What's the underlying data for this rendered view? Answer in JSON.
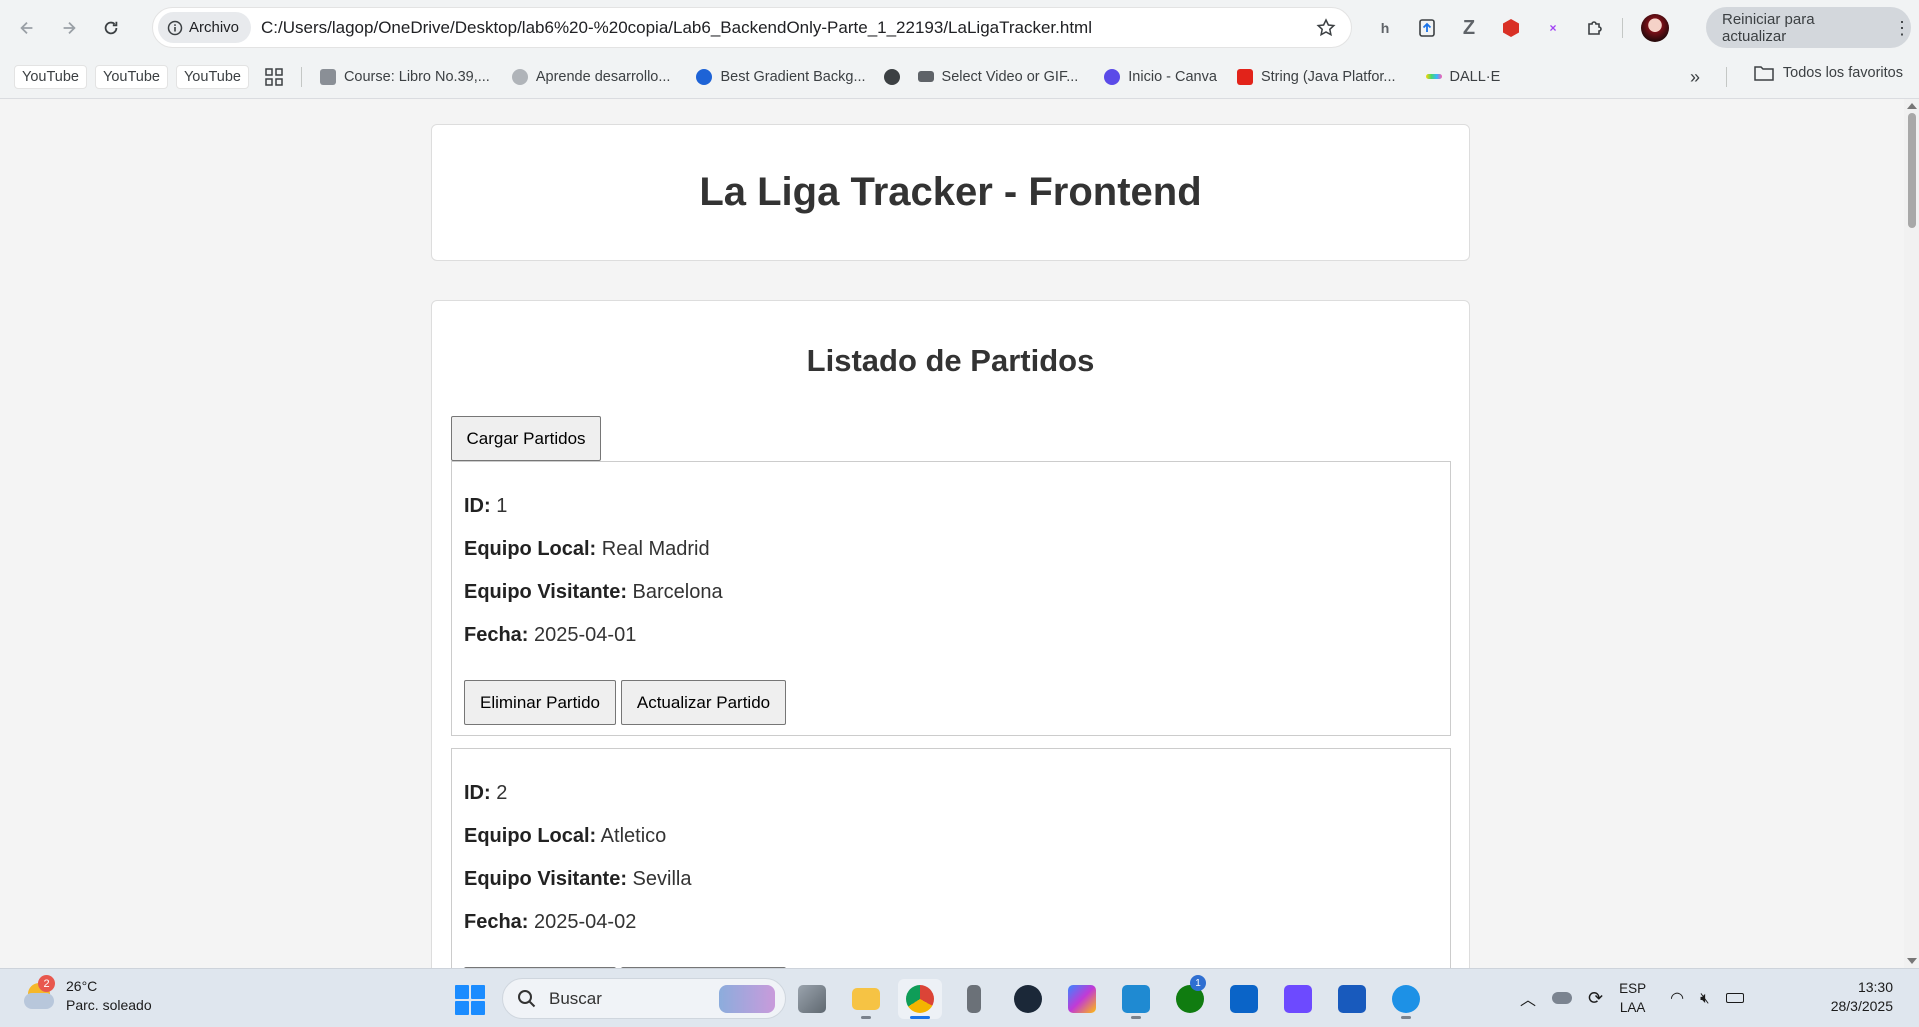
{
  "browser": {
    "chip_label": "Archivo",
    "url": "C:/Users/lagop/OneDrive/Desktop/lab6%20-%20copia/Lab6_BackendOnly-Parte_1_22193/LaLigaTracker.html",
    "restart_label": "Reiniciar para actualizar",
    "bookmarks": [
      {
        "label": "YouTube",
        "icon": "youtube-chip"
      },
      {
        "label": "YouTube",
        "icon": "youtube-chip"
      },
      {
        "label": "YouTube",
        "icon": "youtube-chip"
      },
      {
        "label": "Course: Libro No.39,...",
        "icon": "course-icon"
      },
      {
        "label": "Aprende desarrollo...",
        "icon": "unity-icon"
      },
      {
        "label": "Best Gradient Backg...",
        "icon": "shield-blue-icon"
      },
      {
        "label": "",
        "icon": "globe-icon"
      },
      {
        "label": "Select Video or GIF...",
        "icon": "video-icon"
      },
      {
        "label": "Inicio - Canva",
        "icon": "canva-icon"
      },
      {
        "label": "String (Java Platfor...",
        "icon": "oracle-icon"
      },
      {
        "label": "DALL·E",
        "icon": "dalle-icon"
      }
    ],
    "all_bookmarks_label": "Todos los favoritos"
  },
  "page": {
    "title": "La Liga Tracker - Frontend",
    "list_heading": "Listado de Partidos",
    "load_button": "Cargar Partidos",
    "labels": {
      "id": "ID:",
      "home": "Equipo Local:",
      "away": "Equipo Visitante:",
      "date": "Fecha:"
    },
    "delete_button": "Eliminar Partido",
    "update_button": "Actualizar Partido",
    "matches": [
      {
        "id": "1",
        "home": "Real Madrid",
        "away": "Barcelona",
        "date": "2025-04-01"
      },
      {
        "id": "2",
        "home": "Atletico",
        "away": "Sevilla",
        "date": "2025-04-02"
      }
    ]
  },
  "taskbar": {
    "weather_badge": "2",
    "temperature": "26°C",
    "condition": "Parc. soleado",
    "search_placeholder": "Buscar",
    "xbox_badge": "1",
    "language_top": "ESP",
    "language_bottom": "LAA",
    "time": "13:30",
    "date": "28/3/2025"
  }
}
